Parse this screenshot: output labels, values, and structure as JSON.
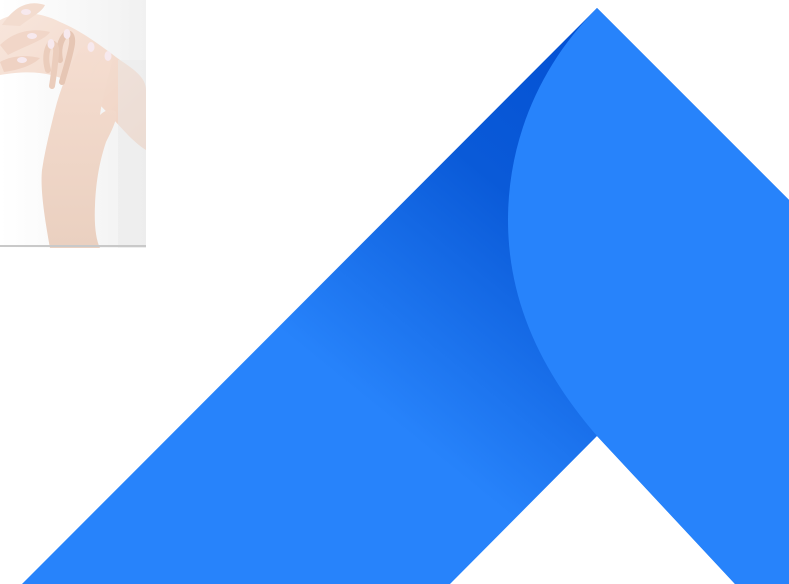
{
  "page": {
    "background": "#ffffff"
  },
  "photo": {
    "subject": "hands-photo",
    "underline_color": "#c9c9c9"
  },
  "logo": {
    "name": "chevron-logo-mark",
    "colors": {
      "main_blue": "#2783fb",
      "shadow_blue": "#0a5ad8",
      "deep_blue": "#0452d4"
    }
  }
}
